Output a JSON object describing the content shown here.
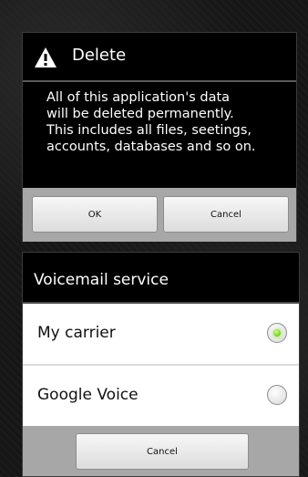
{
  "delete_dialog": {
    "title": "Delete",
    "title_icon": "warning-triangle-icon",
    "message": "All of this application's data\nwill be deleted permanently.\nThis includes all files, seetings,\naccounts, databases and so on.",
    "ok_label": "OK",
    "cancel_label": "Cancel"
  },
  "voicemail_dialog": {
    "title": "Voicemail service",
    "options": [
      {
        "label": "My carrier",
        "selected": true
      },
      {
        "label": "Google Voice",
        "selected": false
      }
    ],
    "cancel_label": "Cancel"
  },
  "colors": {
    "radio_selected": "#53b800",
    "button_bar": "#a7a7a7"
  }
}
